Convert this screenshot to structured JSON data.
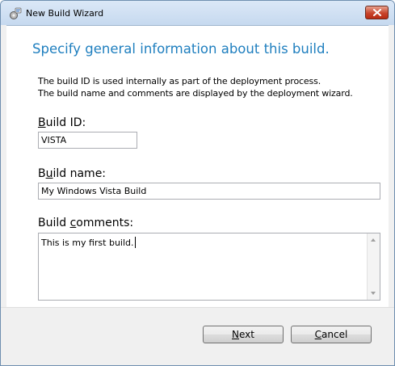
{
  "window": {
    "title": "New Build Wizard",
    "app_icon": "wizard-gear-icon",
    "close_icon": "close-icon"
  },
  "page": {
    "heading": "Specify general information about this build.",
    "description_line1": "The build ID is used internally as part of the deployment process.",
    "description_line2": "The build name and comments are displayed by the deployment wizard."
  },
  "fields": {
    "build_id": {
      "label_mnemonic": "B",
      "label_rest": "uild ID:",
      "value": "VISTA"
    },
    "build_name": {
      "label_pre": "B",
      "label_mnemonic": "u",
      "label_rest": "ild name:",
      "value": "My Windows Vista Build"
    },
    "build_comments": {
      "label_pre": "Build ",
      "label_mnemonic": "c",
      "label_rest": "omments:",
      "value": "This is my first build."
    }
  },
  "buttons": {
    "next_mnemonic": "N",
    "next_rest": "ext",
    "cancel_mnemonic": "C",
    "cancel_rest": "ancel"
  },
  "colors": {
    "heading": "#1f7fbf",
    "close_button": "#c8452c",
    "titlebar": "#c6d9ef"
  }
}
